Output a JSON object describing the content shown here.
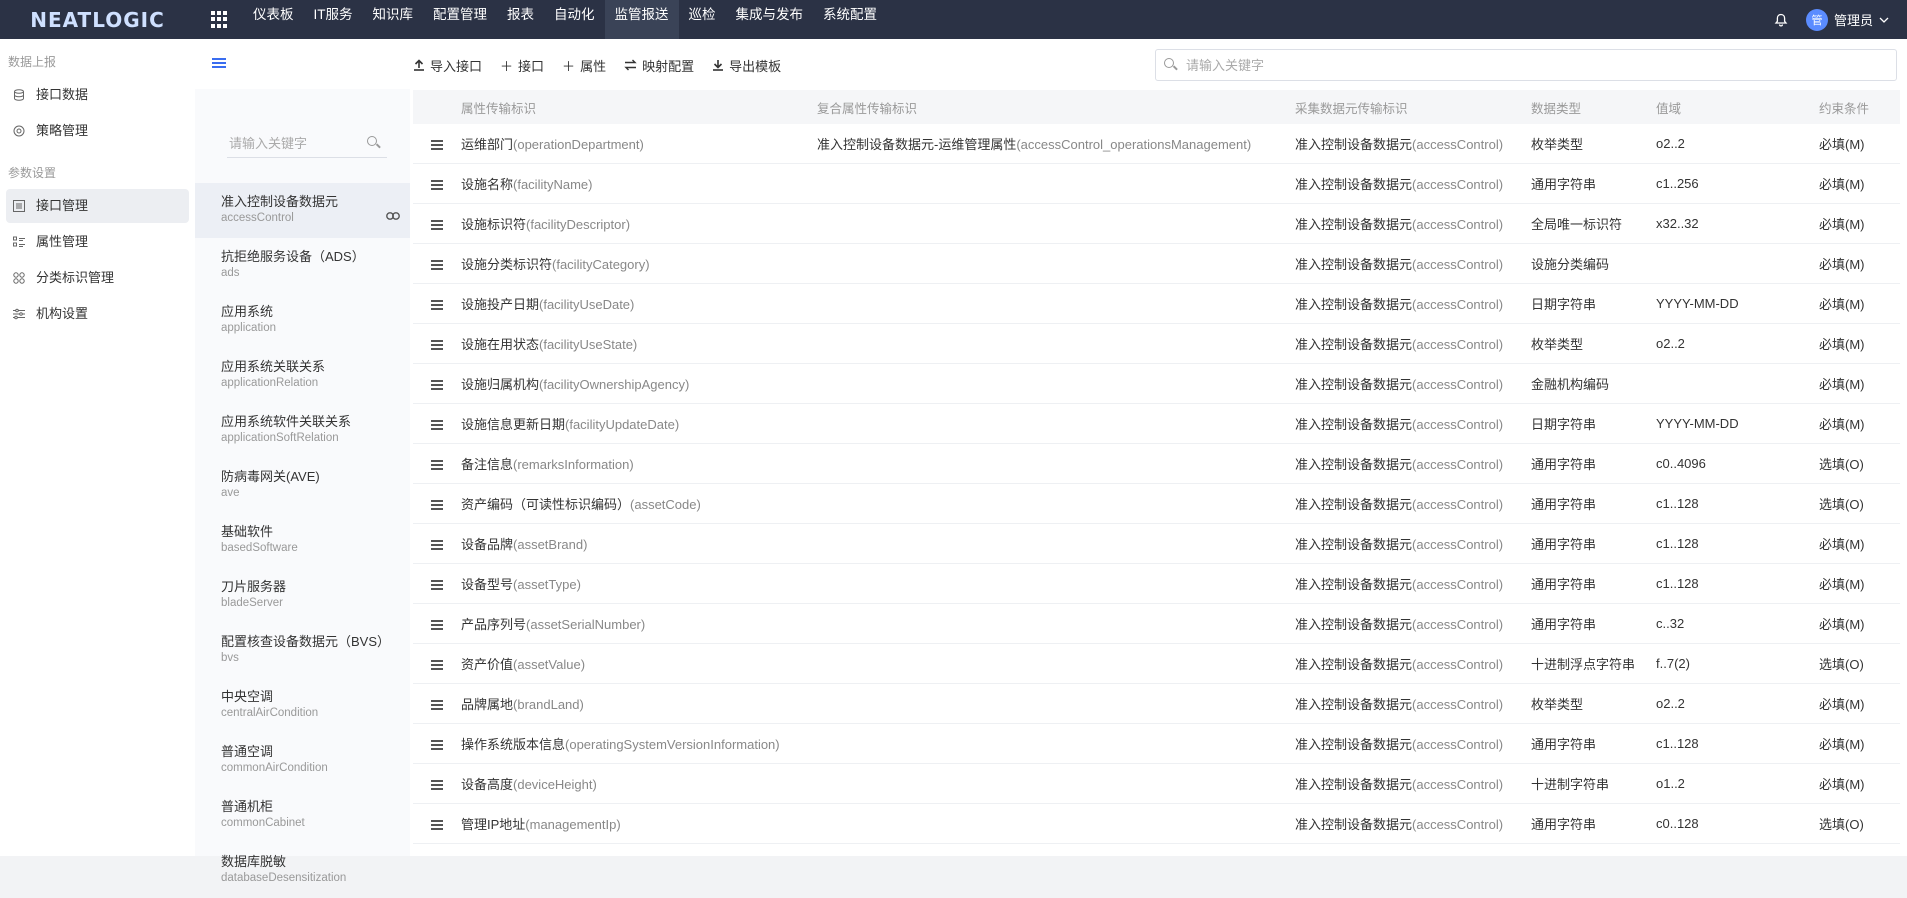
{
  "app": {
    "logo": "NEATLOGIC"
  },
  "nav": {
    "items": [
      "仪表板",
      "IT服务",
      "知识库",
      "配置管理",
      "报表",
      "自动化",
      "监管报送",
      "巡检",
      "集成与发布",
      "系统配置"
    ],
    "active_index": 6
  },
  "user": {
    "avatar_text": "管",
    "name": "管理员"
  },
  "sidebar": {
    "groups": [
      {
        "title": "数据上报",
        "items": [
          {
            "label": "接口数据"
          },
          {
            "label": "策略管理"
          }
        ]
      },
      {
        "title": "参数设置",
        "items": [
          {
            "label": "接口管理"
          },
          {
            "label": "属性管理"
          },
          {
            "label": "分类标识管理"
          },
          {
            "label": "机构设置"
          }
        ]
      }
    ]
  },
  "toolbar": {
    "import_label": "导入接口",
    "add_interface_label": "接口",
    "add_attribute_label": "属性",
    "mapping_label": "映射配置",
    "export_label": "导出模板",
    "search_placeholder": "请输入关键字"
  },
  "interface_panel": {
    "search_placeholder": "请输入关键字",
    "items": [
      {
        "name": "准入控制设备数据元",
        "code": "accessControl"
      },
      {
        "name": "抗拒绝服务设备（ADS）",
        "code": "ads"
      },
      {
        "name": "应用系统",
        "code": "application"
      },
      {
        "name": "应用系统关联关系",
        "code": "applicationRelation"
      },
      {
        "name": "应用系统软件关联关系",
        "code": "applicationSoftRelation"
      },
      {
        "name": "防病毒网关(AVE)",
        "code": "ave"
      },
      {
        "name": "基础软件",
        "code": "basedSoftware"
      },
      {
        "name": "刀片服务器",
        "code": "bladeServer"
      },
      {
        "name": "配置核查设备数据元（BVS）",
        "code": "bvs"
      },
      {
        "name": "中央空调",
        "code": "centralAirCondition"
      },
      {
        "name": "普通空调",
        "code": "commonAirCondition"
      },
      {
        "name": "普通机柜",
        "code": "commonCabinet"
      },
      {
        "name": "数据库脱敏",
        "code": "databaseDesensitization"
      }
    ]
  },
  "table": {
    "headers": [
      "属性传输标识",
      "复合属性传输标识",
      "采集数据元传输标识",
      "数据类型",
      "值域",
      "约束条件"
    ],
    "rows": [
      {
        "attr_zh": "运维部门",
        "attr_en": "(operationDepartment)",
        "comp_zh": "准入控制设备数据元-运维管理属性",
        "comp_en": "(accessControl_operationsManagement)",
        "coll_zh": "准入控制设备数据元",
        "coll_en": "(accessControl)",
        "type": "枚举类型",
        "range": "o2..2",
        "constraint": "必填(M)"
      },
      {
        "attr_zh": "设施名称",
        "attr_en": "(facilityName)",
        "comp_zh": "",
        "comp_en": "",
        "coll_zh": "准入控制设备数据元",
        "coll_en": "(accessControl)",
        "type": "通用字符串",
        "range": "c1..256",
        "constraint": "必填(M)"
      },
      {
        "attr_zh": "设施标识符",
        "attr_en": "(facilityDescriptor)",
        "comp_zh": "",
        "comp_en": "",
        "coll_zh": "准入控制设备数据元",
        "coll_en": "(accessControl)",
        "type": "全局唯一标识符",
        "range": "x32..32",
        "constraint": "必填(M)"
      },
      {
        "attr_zh": "设施分类标识符",
        "attr_en": "(facilityCategory)",
        "comp_zh": "",
        "comp_en": "",
        "coll_zh": "准入控制设备数据元",
        "coll_en": "(accessControl)",
        "type": "设施分类编码",
        "range": "",
        "constraint": "必填(M)"
      },
      {
        "attr_zh": "设施投产日期",
        "attr_en": "(facilityUseDate)",
        "comp_zh": "",
        "comp_en": "",
        "coll_zh": "准入控制设备数据元",
        "coll_en": "(accessControl)",
        "type": "日期字符串",
        "range": "YYYY-MM-DD",
        "constraint": "必填(M)"
      },
      {
        "attr_zh": "设施在用状态",
        "attr_en": "(facilityUseState)",
        "comp_zh": "",
        "comp_en": "",
        "coll_zh": "准入控制设备数据元",
        "coll_en": "(accessControl)",
        "type": "枚举类型",
        "range": "o2..2",
        "constraint": "必填(M)"
      },
      {
        "attr_zh": "设施归属机构",
        "attr_en": "(facilityOwnershipAgency)",
        "comp_zh": "",
        "comp_en": "",
        "coll_zh": "准入控制设备数据元",
        "coll_en": "(accessControl)",
        "type": "金融机构编码",
        "range": "",
        "constraint": "必填(M)"
      },
      {
        "attr_zh": "设施信息更新日期",
        "attr_en": "(facilityUpdateDate)",
        "comp_zh": "",
        "comp_en": "",
        "coll_zh": "准入控制设备数据元",
        "coll_en": "(accessControl)",
        "type": "日期字符串",
        "range": "YYYY-MM-DD",
        "constraint": "必填(M)"
      },
      {
        "attr_zh": "备注信息",
        "attr_en": "(remarksInformation)",
        "comp_zh": "",
        "comp_en": "",
        "coll_zh": "准入控制设备数据元",
        "coll_en": "(accessControl)",
        "type": "通用字符串",
        "range": "c0..4096",
        "constraint": "选填(O)"
      },
      {
        "attr_zh": "资产编码（可读性标识编码）",
        "attr_en": "(assetCode)",
        "comp_zh": "",
        "comp_en": "",
        "coll_zh": "准入控制设备数据元",
        "coll_en": "(accessControl)",
        "type": "通用字符串",
        "range": "c1..128",
        "constraint": "选填(O)"
      },
      {
        "attr_zh": "设备品牌",
        "attr_en": "(assetBrand)",
        "comp_zh": "",
        "comp_en": "",
        "coll_zh": "准入控制设备数据元",
        "coll_en": "(accessControl)",
        "type": "通用字符串",
        "range": "c1..128",
        "constraint": "必填(M)"
      },
      {
        "attr_zh": "设备型号",
        "attr_en": "(assetType)",
        "comp_zh": "",
        "comp_en": "",
        "coll_zh": "准入控制设备数据元",
        "coll_en": "(accessControl)",
        "type": "通用字符串",
        "range": "c1..128",
        "constraint": "必填(M)"
      },
      {
        "attr_zh": "产品序列号",
        "attr_en": "(assetSerialNumber)",
        "comp_zh": "",
        "comp_en": "",
        "coll_zh": "准入控制设备数据元",
        "coll_en": "(accessControl)",
        "type": "通用字符串",
        "range": "c..32",
        "constraint": "必填(M)"
      },
      {
        "attr_zh": "资产价值",
        "attr_en": "(assetValue)",
        "comp_zh": "",
        "comp_en": "",
        "coll_zh": "准入控制设备数据元",
        "coll_en": "(accessControl)",
        "type": "十进制浮点字符串",
        "range": "f..7(2)",
        "constraint": "选填(O)"
      },
      {
        "attr_zh": "品牌属地",
        "attr_en": "(brandLand)",
        "comp_zh": "",
        "comp_en": "",
        "coll_zh": "准入控制设备数据元",
        "coll_en": "(accessControl)",
        "type": "枚举类型",
        "range": "o2..2",
        "constraint": "必填(M)"
      },
      {
        "attr_zh": "操作系统版本信息",
        "attr_en": "(operatingSystemVersionInformation)",
        "comp_zh": "",
        "comp_en": "",
        "coll_zh": "准入控制设备数据元",
        "coll_en": "(accessControl)",
        "type": "通用字符串",
        "range": "c1..128",
        "constraint": "必填(M)"
      },
      {
        "attr_zh": "设备高度",
        "attr_en": "(deviceHeight)",
        "comp_zh": "",
        "comp_en": "",
        "coll_zh": "准入控制设备数据元",
        "coll_en": "(accessControl)",
        "type": "十进制字符串",
        "range": "o1..2",
        "constraint": "必填(M)"
      },
      {
        "attr_zh": "管理IP地址",
        "attr_en": "(managementIp)",
        "comp_zh": "",
        "comp_en": "",
        "coll_zh": "准入控制设备数据元",
        "coll_en": "(accessControl)",
        "type": "通用字符串",
        "range": "c0..128",
        "constraint": "选填(O)"
      }
    ]
  },
  "colors": {
    "topbar": "#2b3245",
    "accent": "#3a6df0"
  }
}
